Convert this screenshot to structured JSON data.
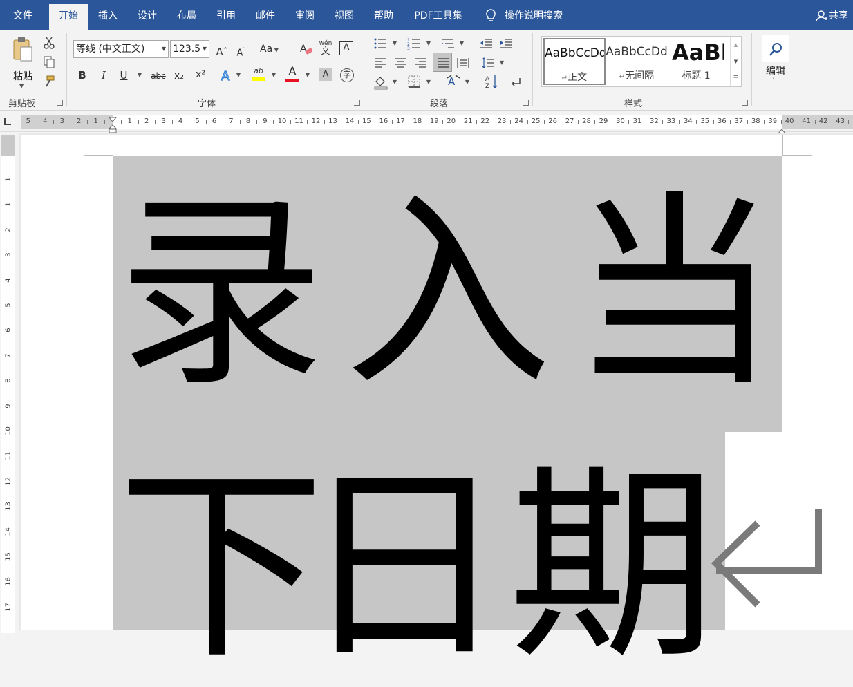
{
  "tabs": {
    "file": "文件",
    "home": "开始",
    "insert": "插入",
    "design": "设计",
    "layout": "布局",
    "references": "引用",
    "mailings": "邮件",
    "review": "审阅",
    "view": "视图",
    "help": "帮助",
    "pdf": "PDF工具集",
    "tell_me": "操作说明搜索",
    "share": "共享"
  },
  "clipboard": {
    "paste": "粘贴",
    "label": "剪贴板"
  },
  "font": {
    "name": "等线 (中文正文)",
    "size": "123.5",
    "change_case": "Aa",
    "phonetic_top": "wén",
    "phonetic_bottom": "文",
    "label": "字体",
    "bold": "B",
    "italic": "I",
    "underline": "U",
    "strike": "abc",
    "subscript": "x₂",
    "superscript": "x²",
    "font_color_glyph": "A",
    "highlight_glyph": "ab"
  },
  "paragraph": {
    "label": "段落"
  },
  "styles": {
    "label": "样式",
    "normal_preview": "AaBbCcDd",
    "normal_name": "正文",
    "nospacing_preview": "AaBbCcDd",
    "nospacing_name": "无间隔",
    "heading1_preview": "AaBb",
    "heading1_name": "标题 1"
  },
  "editing": {
    "label": "编辑"
  },
  "ruler": {
    "left_numbers": [
      "5",
      "4",
      "3",
      "2",
      "1"
    ],
    "right_numbers": [
      "1",
      "2",
      "3",
      "4",
      "5",
      "6",
      "7",
      "8",
      "9",
      "10",
      "11",
      "12",
      "13",
      "14",
      "15",
      "16",
      "17",
      "18",
      "19",
      "20",
      "21",
      "22",
      "23",
      "24",
      "25",
      "26",
      "27",
      "28",
      "29",
      "30",
      "31",
      "32",
      "33",
      "34",
      "35",
      "36",
      "37",
      "38",
      "39",
      "40",
      "41",
      "42",
      "43"
    ],
    "vertical_numbers": [
      "1",
      "1",
      "2",
      "3",
      "4",
      "5",
      "6",
      "7",
      "8",
      "9",
      "10",
      "11",
      "12",
      "13",
      "14",
      "15",
      "16",
      "17",
      "18"
    ]
  },
  "document": {
    "line1": [
      "录",
      "入",
      "当"
    ],
    "line2": [
      "下",
      "日",
      "期"
    ],
    "paragraph_mark": "↵"
  },
  "colors": {
    "accent": "#2b579a",
    "selection": "#c6c6c6",
    "font_color_bar": "#e81123",
    "highlight_bar": "#ffff00"
  }
}
